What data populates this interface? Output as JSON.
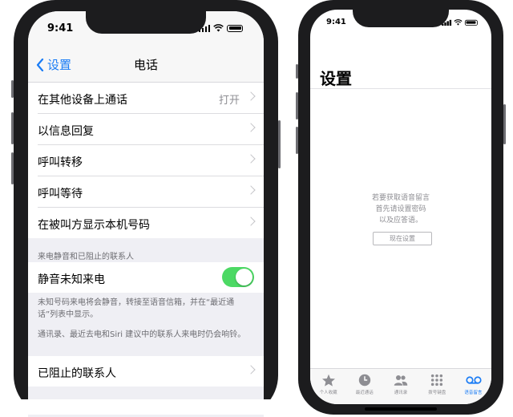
{
  "left": {
    "time": "9:41",
    "nav": {
      "back_label": "设置",
      "title": "电话"
    },
    "group1": [
      {
        "label": "在其他设备上通话",
        "value": "打开"
      },
      {
        "label": "以信息回复",
        "value": ""
      },
      {
        "label": "呼叫转移",
        "value": ""
      },
      {
        "label": "呼叫等待",
        "value": ""
      },
      {
        "label": "在被叫方显示本机号码",
        "value": ""
      }
    ],
    "section_header": "来电静音和已阻止的联系人",
    "silence_label": "静音未知来电",
    "silence_on": true,
    "footer1": "未知号码来电将会静音，转接至语音信箱，并在“最近通话”列表中显示。",
    "footer2": "通讯录、最近去电和Siri 建议中的联系人来电时仍会响铃。",
    "blocked_label": "已阻止的联系人"
  },
  "right": {
    "time": "9:41",
    "title": "设置",
    "message_lines": [
      "若要获取语音留言",
      "首先请设置密码",
      "以及应答语。"
    ],
    "setup_button": "现在设置",
    "tabs": [
      {
        "label": "个人收藏",
        "icon": "star-icon",
        "active": false
      },
      {
        "label": "最近通话",
        "icon": "clock-icon",
        "active": false
      },
      {
        "label": "通讯录",
        "icon": "contacts-icon",
        "active": false
      },
      {
        "label": "拨号键盘",
        "icon": "keypad-icon",
        "active": false
      },
      {
        "label": "语音留言",
        "icon": "voicemail-icon",
        "active": true
      }
    ],
    "accent": "#1a7cf5"
  },
  "colors": {
    "toggle_on": "#4cd964",
    "link": "#1a7cf5"
  }
}
